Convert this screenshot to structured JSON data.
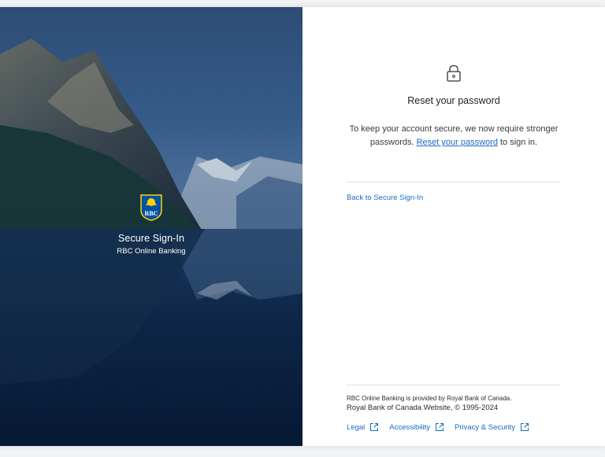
{
  "hero": {
    "title": "Secure Sign-In",
    "subtitle": "RBC Online Banking",
    "logo_text": "RBC",
    "logo_icon": "rbc-shield-logo"
  },
  "panel": {
    "lock_icon": "lock-icon",
    "heading": "Reset your password",
    "message_before": "To keep your account secure, we now require stronger passwords.",
    "message_link": "Reset your password",
    "message_after": "to sign in.",
    "back_link": "Back to Secure Sign-In"
  },
  "footer": {
    "provided_by": "RBC Online Banking is provided by Royal Bank of Canada.",
    "copyright": "Royal Bank of Canada Website, © 1995-2024",
    "links": [
      {
        "label": "Legal",
        "icon": "external-link-icon"
      },
      {
        "label": "Accessibility",
        "icon": "external-link-icon"
      },
      {
        "label": "Privacy & Security",
        "icon": "external-link-icon"
      }
    ]
  },
  "colors": {
    "link": "#1a6bc4",
    "logo_blue": "#0051a5",
    "logo_gold": "#ffd200"
  }
}
